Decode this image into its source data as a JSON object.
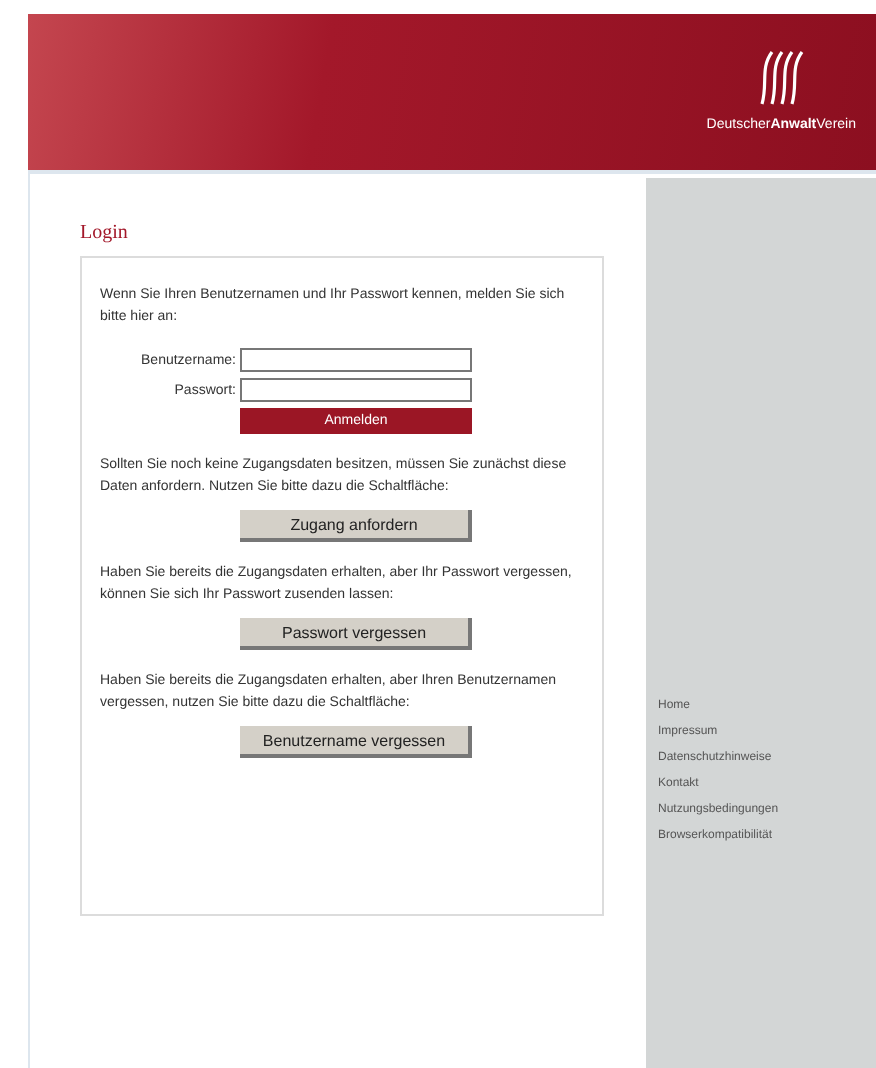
{
  "header": {
    "logo_text": "Deutscher**Anwalt**Verein"
  },
  "login": {
    "title": "Login",
    "intro": "Wenn Sie Ihren Benutzernamen und Ihr Passwort kennen, melden Sie sich bitte hier an:",
    "fields": [
      {
        "label": "Benutzername:"
      },
      {
        "label": "Passwort:"
      }
    ],
    "submit": "Anmelden",
    "sections": [
      {
        "text": "Sollten Sie noch keine Zugangsdaten besitzen, müssen Sie zunächst diese Daten anfordern. Nutzen Sie bitte dazu die Schaltfläche:",
        "button": "Zugang anfordern"
      },
      {
        "text": "Haben Sie bereits die Zugangsdaten erhalten, aber Ihr Passwort vergessen, können Sie sich Ihr Passwort zusenden lassen:",
        "button": "Passwort vergessen"
      },
      {
        "text": "Haben Sie bereits die Zugangsdaten erhalten, aber Ihren Benutzernamen vergessen, nutzen Sie bitte dazu die Schaltfläche:",
        "button": "Benutzername vergessen"
      }
    ]
  },
  "sidebar": {
    "links": [
      "Home",
      "Impressum",
      "Datenschutzhinweise",
      "Kontakt",
      "Nutzungsbedingungen",
      "Browserkompatibilität"
    ]
  }
}
